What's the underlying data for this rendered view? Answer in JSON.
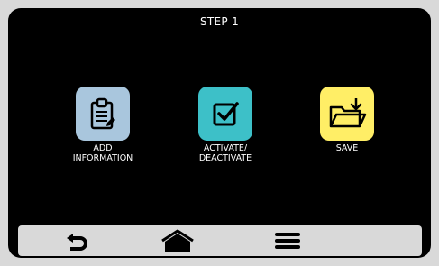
{
  "header": {
    "title": "STEP 1"
  },
  "tiles": [
    {
      "label": "ADD INFORMATION",
      "icon": "clipboard-icon",
      "color": "#a9c6dd"
    },
    {
      "label": "ACTIVATE/ DEACTIVATE",
      "icon": "checkbox-icon",
      "color": "#3dc0c8"
    },
    {
      "label": "SAVE",
      "icon": "folder-save-icon",
      "color": "#ffee66"
    }
  ],
  "navbar": {
    "buttons": [
      {
        "icon": "back-arrow-icon"
      },
      {
        "icon": "home-icon"
      },
      {
        "icon": "menu-icon"
      }
    ],
    "background": "#d9d9d9"
  },
  "colors": {
    "screen_bg": "#000000",
    "text": "#ffffff",
    "icon_ink": "#000000"
  }
}
